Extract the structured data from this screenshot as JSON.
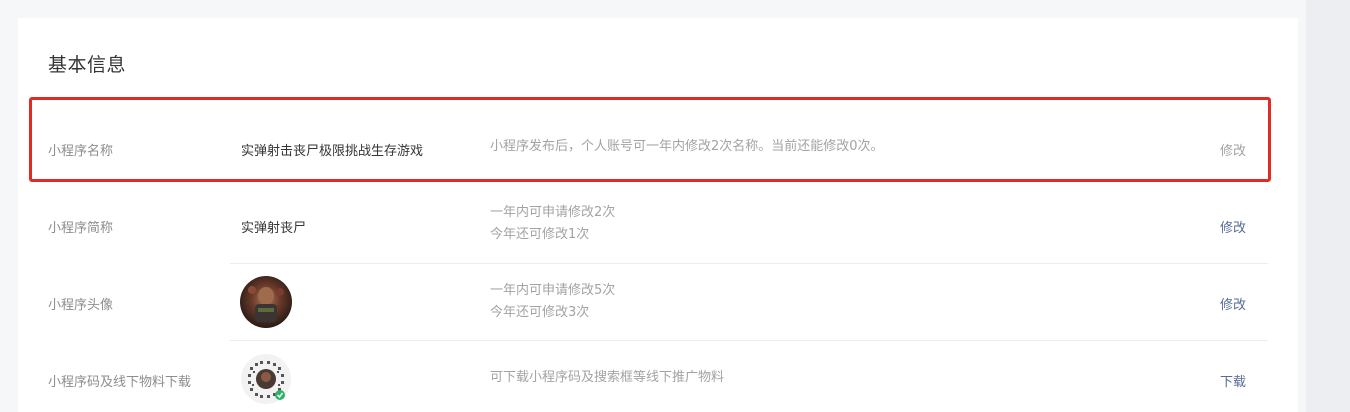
{
  "section": {
    "title": "基本信息"
  },
  "rows": [
    {
      "label": "小程序名称",
      "value": "实弹射击丧尸极限挑战生存游戏",
      "desc_line1": "小程序发布后，个人账号可一年内修改2次名称。当前还能修改0次。",
      "action": "修改"
    },
    {
      "label": "小程序简称",
      "value": "实弹射丧尸",
      "desc_line1": "一年内可申请修改2次",
      "desc_line2": "今年还可修改1次",
      "action": "修改"
    },
    {
      "label": "小程序头像",
      "desc_line1": "一年内可申请修改5次",
      "desc_line2": "今年还可修改3次",
      "action": "修改"
    },
    {
      "label": "小程序码及线下物料下载",
      "desc_line1": "可下载小程序码及搜索框等线下推广物料",
      "action": "下载"
    }
  ],
  "colors": {
    "highlight": "#e12b25",
    "link": "#576b95",
    "muted": "#a3a3a3"
  }
}
